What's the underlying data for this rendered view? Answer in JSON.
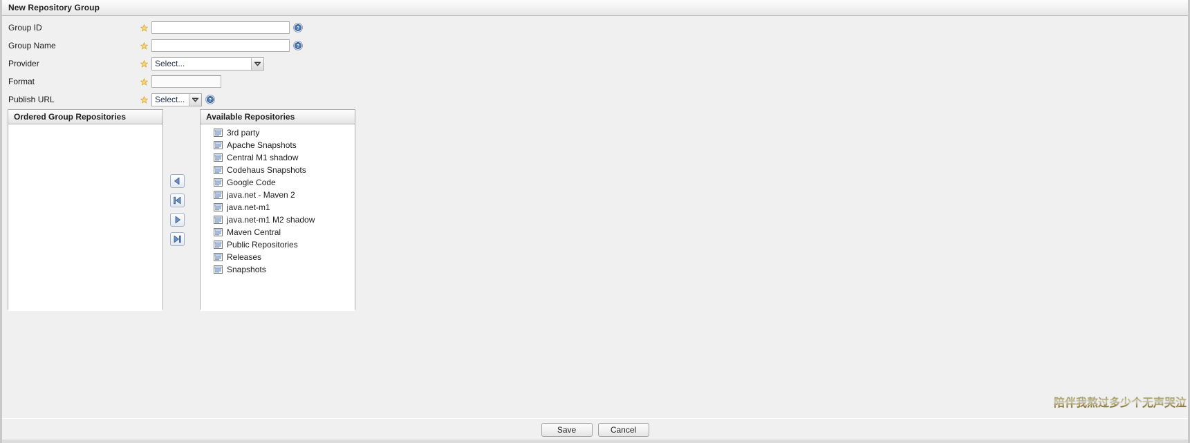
{
  "window": {
    "title": "New Repository Group"
  },
  "form": {
    "rows": [
      {
        "label": "Group ID",
        "required": true,
        "control": "text",
        "value": "",
        "placeholder": "",
        "help": true
      },
      {
        "label": "Group Name",
        "required": true,
        "control": "text",
        "value": "",
        "placeholder": "",
        "help": true
      },
      {
        "label": "Provider",
        "required": true,
        "control": "select",
        "value": "Select...",
        "help": false
      },
      {
        "label": "Format",
        "required": true,
        "control": "text",
        "value": "",
        "placeholder": "",
        "help": false
      },
      {
        "label": "Publish URL",
        "required": true,
        "control": "select",
        "value": "Select...",
        "help": true
      }
    ],
    "required_marker": "star-icon",
    "help_marker": "help-icon"
  },
  "ordered_group_repositories": {
    "title": "Ordered Group Repositories",
    "items": []
  },
  "available_repositories": {
    "title": "Available Repositories",
    "items": [
      "3rd party",
      "Apache Snapshots",
      "Central M1 shadow",
      "Codehaus Snapshots",
      "Google Code",
      "java.net - Maven 2",
      "java.net-m1",
      "java.net-m1 M2 shadow",
      "Maven Central",
      "Public Repositories",
      "Releases",
      "Snapshots"
    ]
  },
  "transfer_buttons": [
    {
      "name": "move-left-icon",
      "glyph": "◀",
      "title": "Add selected"
    },
    {
      "name": "move-all-left-icon",
      "glyph": "⏮",
      "title": "Add all"
    },
    {
      "name": "move-right-icon",
      "glyph": "▶",
      "title": "Remove selected"
    },
    {
      "name": "move-all-right-icon",
      "glyph": "⏭",
      "title": "Remove all"
    }
  ],
  "footer": {
    "save_label": "Save",
    "cancel_label": "Cancel"
  },
  "watermark": {
    "text": "陪伴我熬过多少个无声哭泣"
  },
  "colors": {
    "accent": "#4a6fa5",
    "required_star": "#f3c64b",
    "help_blue": "#3a6ea5",
    "panel_border": "#adadad",
    "background": "#f0f0f0"
  }
}
